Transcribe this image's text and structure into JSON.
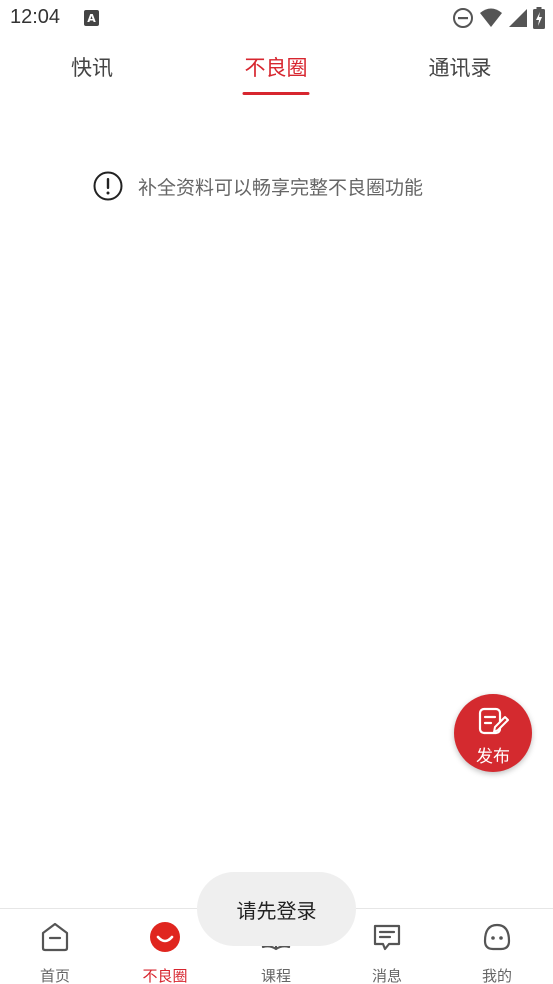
{
  "status_bar": {
    "time": "12:04",
    "icons": [
      "a-notification-icon",
      "do-not-disturb-icon",
      "wifi-icon",
      "signal-icon",
      "battery-charging-icon"
    ]
  },
  "top_tabs": {
    "items": [
      {
        "label": "快讯",
        "active": false
      },
      {
        "label": "不良圈",
        "active": true
      },
      {
        "label": "通讯录",
        "active": false
      }
    ],
    "accent_color": "#d7262f"
  },
  "notice": {
    "icon": "exclamation-circle-icon",
    "text": "补全资料可以畅享完整不良圈功能"
  },
  "fab": {
    "icon": "edit-note-icon",
    "label": "发布",
    "color": "#d42a2f"
  },
  "bottom_nav": {
    "items": [
      {
        "label": "首页",
        "icon": "home-icon",
        "active": false
      },
      {
        "label": "不良圈",
        "icon": "smile-circle-icon",
        "active": true
      },
      {
        "label": "课程",
        "icon": "book-icon",
        "active": false
      },
      {
        "label": "消息",
        "icon": "message-icon",
        "active": false
      },
      {
        "label": "我的",
        "icon": "profile-blob-icon",
        "active": false
      }
    ]
  },
  "toast": {
    "text": "请先登录"
  }
}
